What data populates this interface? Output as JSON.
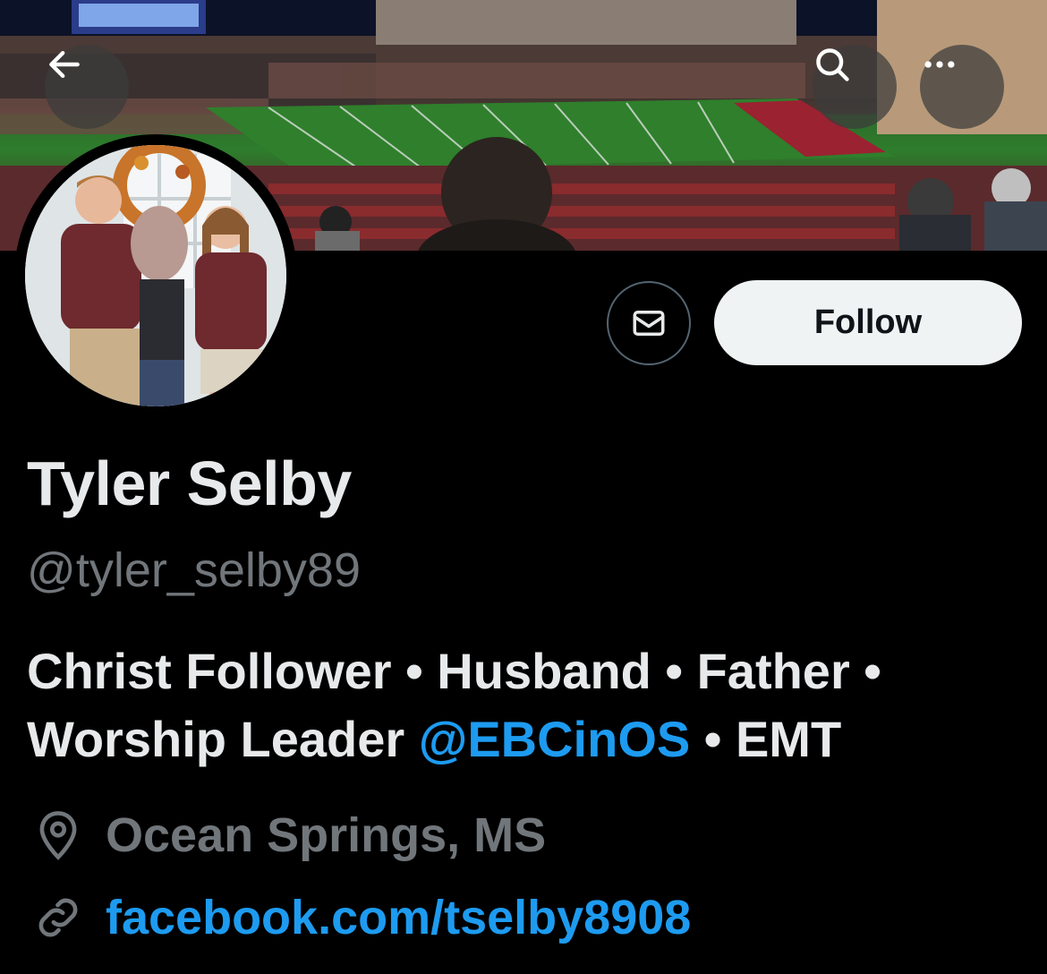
{
  "header": {
    "back_icon": "arrow-left-icon",
    "search_icon": "search-icon",
    "more_icon": "more-horizontal-icon"
  },
  "profile": {
    "name": "Tyler Selby",
    "handle": "@tyler_selby89",
    "bio_part1": "Christ Follower • Husband • Father • Worship Leader ",
    "bio_mention": "@EBCinOS",
    "bio_part2": " • EMT",
    "location": "Ocean Springs, MS",
    "link": "facebook.com/tselby8908"
  },
  "actions": {
    "message_icon": "envelope-icon",
    "follow_label": "Follow"
  },
  "colors": {
    "background": "#000000",
    "text_primary": "#e7e9ea",
    "text_secondary": "#71767b",
    "link": "#1d9bf0",
    "follow_bg": "#eff3f4"
  }
}
